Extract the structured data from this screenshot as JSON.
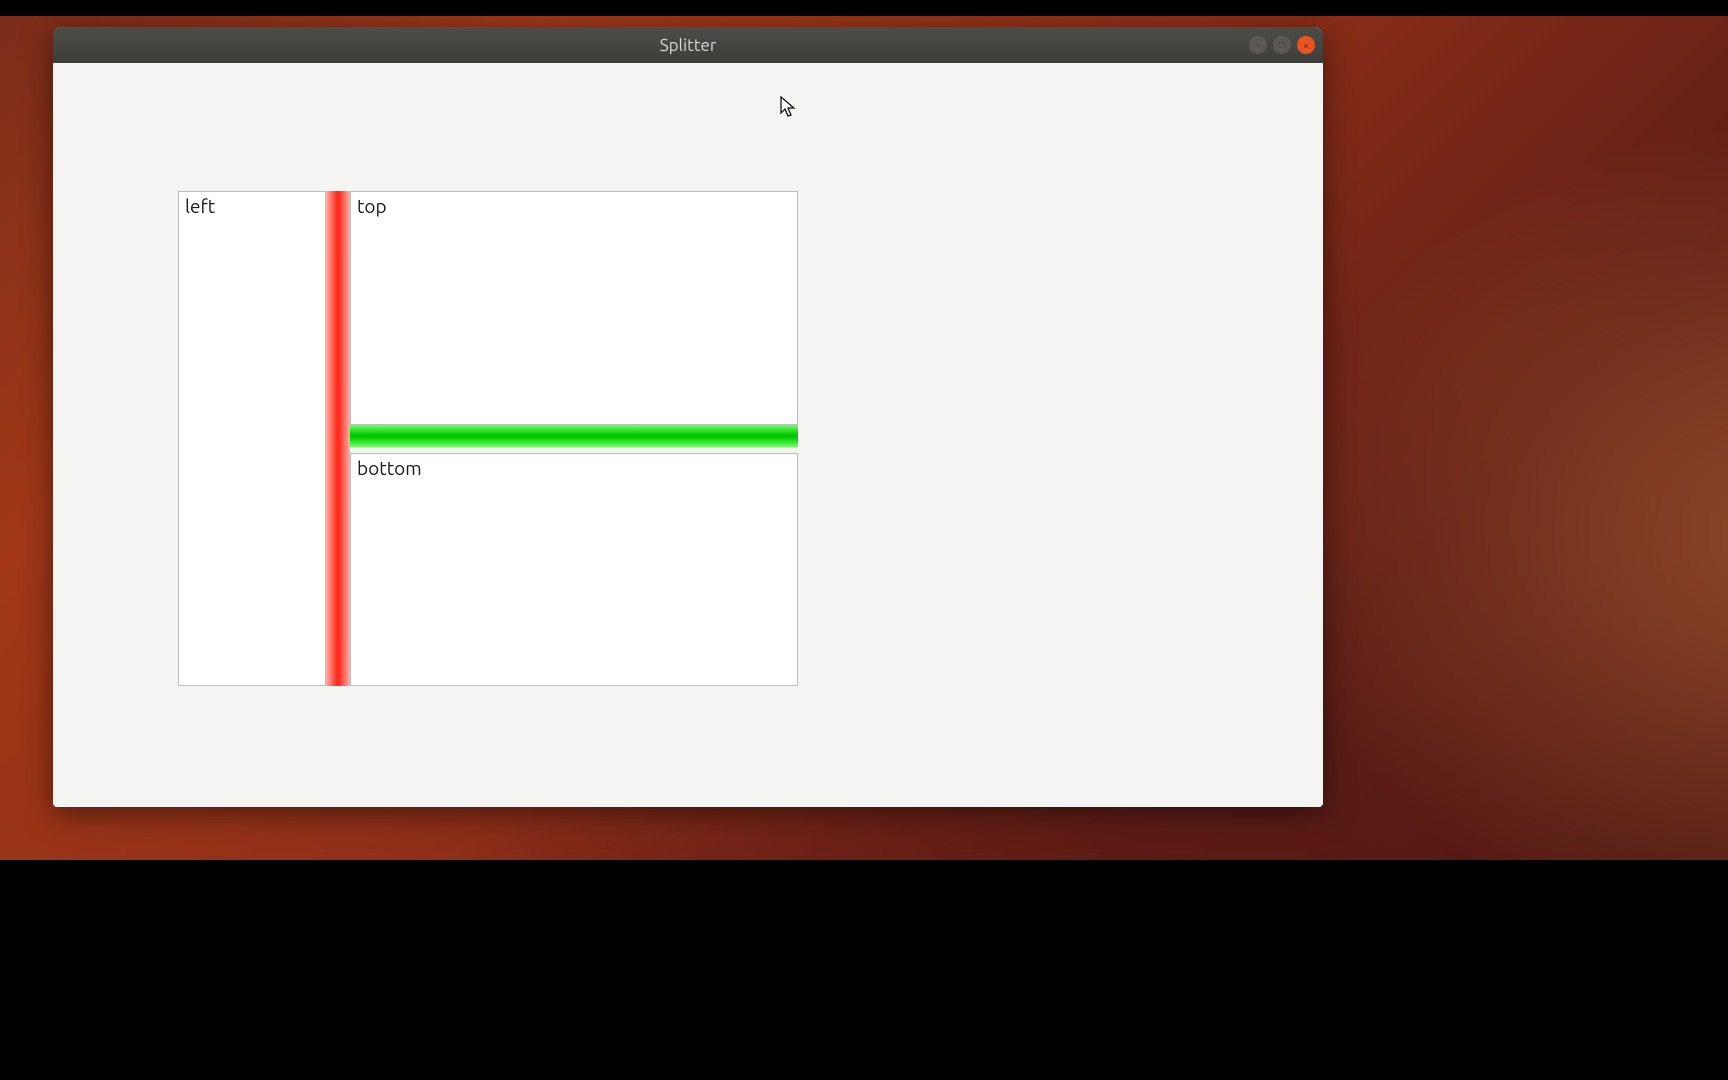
{
  "window": {
    "title": "Splitter"
  },
  "panes": {
    "left": "left",
    "top": "top",
    "bottom": "bottom"
  },
  "splitters": {
    "vertical_color": "#ff2d1f",
    "horizontal_color": "#00c800"
  }
}
